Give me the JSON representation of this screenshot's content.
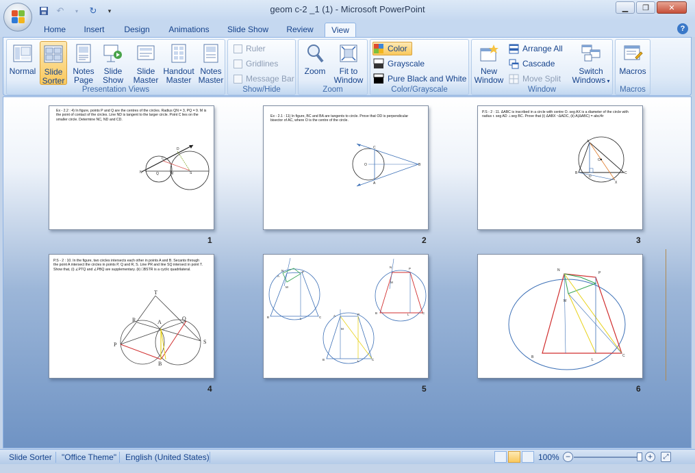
{
  "window": {
    "title": "geom c-2 _1 (1) - Microsoft PowerPoint"
  },
  "tabs": [
    "Home",
    "Insert",
    "Design",
    "Animations",
    "Slide Show",
    "Review",
    "View"
  ],
  "active_tab": "View",
  "ribbon": {
    "presentation_views": {
      "label": "Presentation Views",
      "normal": "Normal",
      "slide_sorter": [
        "Slide",
        "Sorter"
      ],
      "notes_page": [
        "Notes",
        "Page"
      ],
      "slide_show": [
        "Slide",
        "Show"
      ],
      "slide_master": [
        "Slide",
        "Master"
      ],
      "handout_master": [
        "Handout",
        "Master"
      ],
      "notes_master": [
        "Notes",
        "Master"
      ]
    },
    "show_hide": {
      "label": "Show/Hide",
      "ruler": "Ruler",
      "gridlines": "Gridlines",
      "message_bar": "Message Bar"
    },
    "zoom": {
      "label": "Zoom",
      "zoom": "Zoom",
      "fit_to_window": [
        "Fit to",
        "Window"
      ]
    },
    "color_grayscale": {
      "label": "Color/Grayscale",
      "color": "Color",
      "grayscale": "Grayscale",
      "pure_bw": "Pure Black and White"
    },
    "window": {
      "label": "Window",
      "new_window": [
        "New",
        "Window"
      ],
      "arrange_all": "Arrange All",
      "cascade": "Cascade",
      "move_split": "Move Split",
      "switch_windows": [
        "Switch",
        "Windows"
      ]
    },
    "macros": {
      "label": "Macros",
      "macros": "Macros"
    }
  },
  "slides": [
    {
      "number": "1",
      "text": "Ex - 2.2 : 4) In figure, points P and Q are the centres of the circles. Radius QN = 3, PQ = 9. M is the point of contact of the circles. Line ND is tangent to the larger circle. Point C lies on the smaller circle. Determine NC, ND and CD."
    },
    {
      "number": "2",
      "text": "Ex - 2.1 : 11) In figure, BC and BA are tangents to circle. Prove that OD is perpendicular bisector of AC, where O is the centre of the circle."
    },
    {
      "number": "3",
      "text": "P.S - 2 : 11. ΔABC is inscribed in a circle with centre O. seg AX is a diameter of the circle with radius r. seg AD ⊥seg BC. Prove that (i) ΔABX ~ΔADC, (ii) A(ΔABC) = abc/4r"
    },
    {
      "number": "4",
      "text": "P.S - 2 : 10. In the figure, two circles intersects each other in points A and B. Secants through the point A intersect the circles in points P, Q and R, S. Line PR and line SQ intersect in point T. Show that, (i) ∠PTQ and ∠PBQ are supplementary. (ii) □BSTR is a cyclic quadrilateral."
    },
    {
      "number": "5",
      "text": ""
    },
    {
      "number": "6",
      "text": ""
    }
  ],
  "status": {
    "view": "Slide Sorter",
    "theme": "\"Office Theme\"",
    "language": "English (United States)",
    "zoom": "100%",
    "zoom_level": 1.0
  }
}
